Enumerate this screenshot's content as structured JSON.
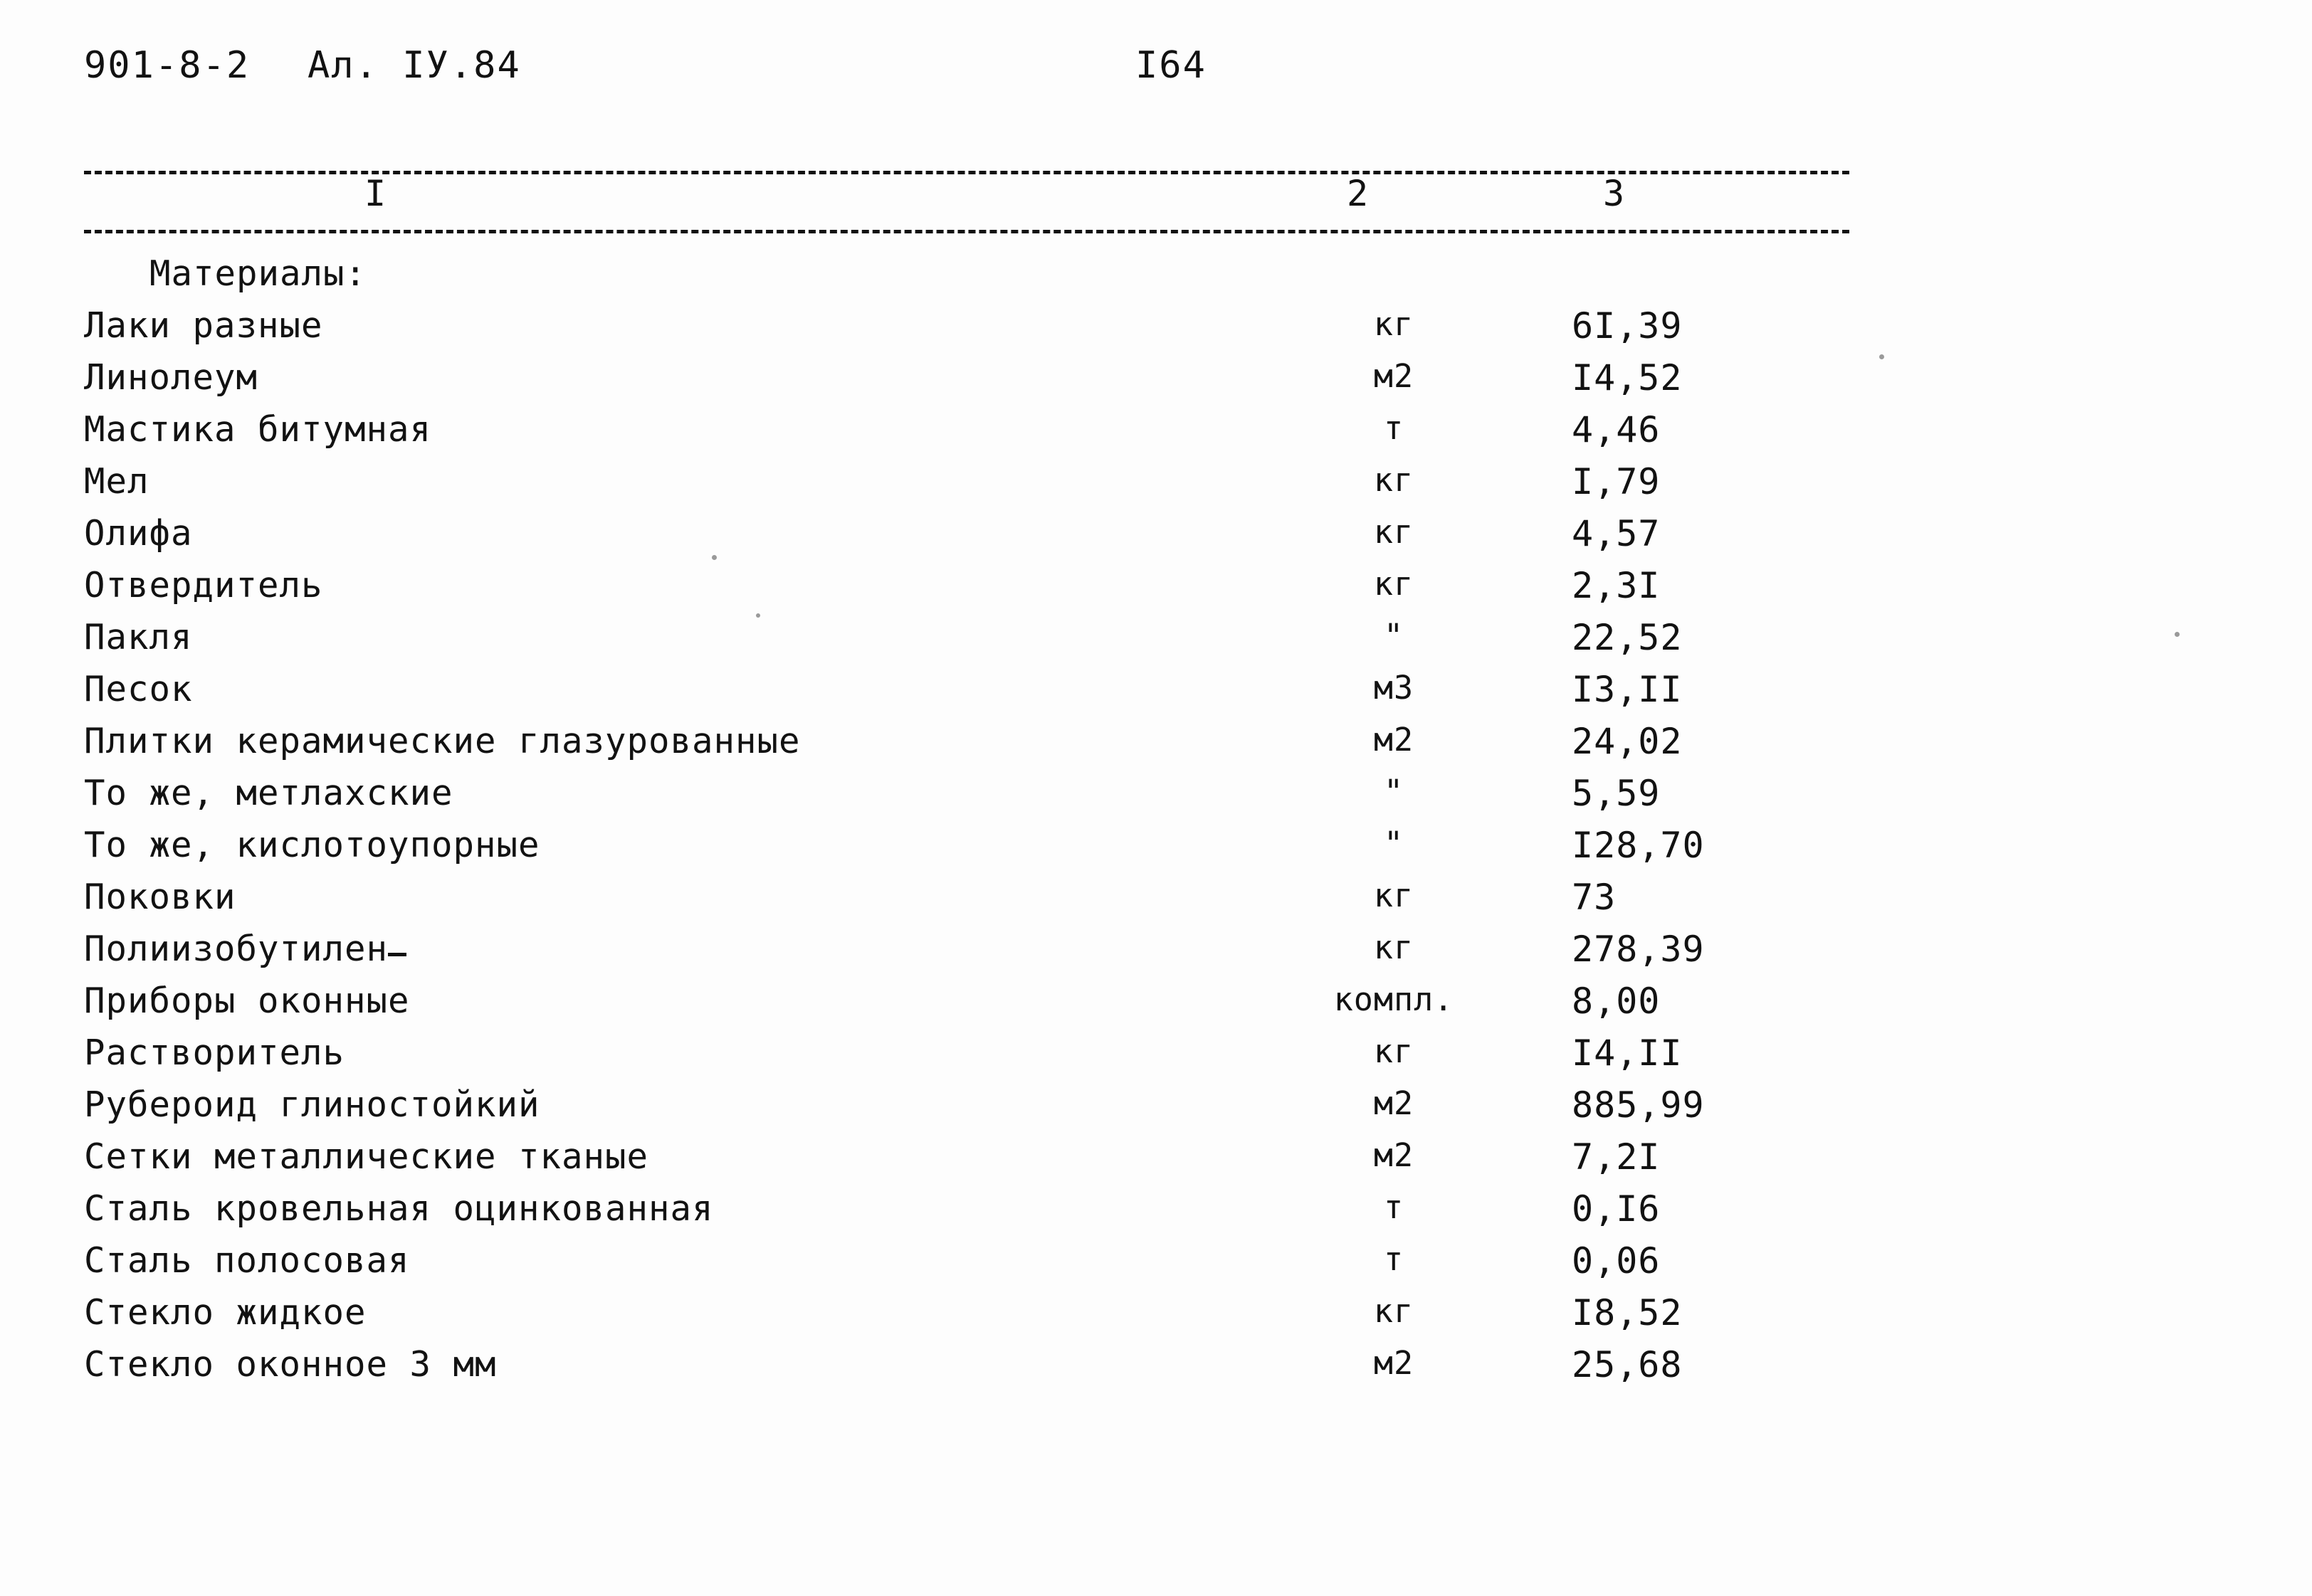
{
  "header": {
    "doc_code": "901-8-2",
    "album": "Ал. IУ.84",
    "page_number": "I64"
  },
  "table": {
    "column_numbers": [
      "I",
      "2",
      "3"
    ],
    "section_title": "Материалы:",
    "rows": [
      {
        "name": "Лаки разные",
        "unit": "кг",
        "value": "6I,39"
      },
      {
        "name": "Линолеум",
        "unit": "м2",
        "value": "I4,52"
      },
      {
        "name": "Мастика битумная",
        "unit": "т",
        "value": "4,46"
      },
      {
        "name": "Мел",
        "unit": "кг",
        "value": "I,79"
      },
      {
        "name": "Олифа",
        "unit": "кг",
        "value": "4,57"
      },
      {
        "name": "Отвердитель",
        "unit": "кг",
        "value": "2,3I"
      },
      {
        "name": "Пакля",
        "unit": "\"",
        "value": "22,52"
      },
      {
        "name": "Песок",
        "unit": "м3",
        "value": "I3,II"
      },
      {
        "name": "Плитки керамические глазурованные",
        "unit": "м2",
        "value": "24,02"
      },
      {
        "name": "То же, метлахские",
        "unit": "\"",
        "value": "5,59"
      },
      {
        "name": "То же, кислотоупорные",
        "unit": "\"",
        "value": "I28,70"
      },
      {
        "name": "Поковки",
        "unit": "кг",
        "value": "73"
      },
      {
        "name": "Полиизобутилен",
        "unit": "кг",
        "value": "278,39"
      },
      {
        "name": "Приборы оконные",
        "unit": "компл.",
        "value": "8,00"
      },
      {
        "name": "Растворитель",
        "unit": "кг",
        "value": "I4,II"
      },
      {
        "name": "Рубероид глиностойкий",
        "unit": "м2",
        "value": "885,99"
      },
      {
        "name": "Сетки металлические тканые",
        "unit": "м2",
        "value": "7,2I"
      },
      {
        "name": "Сталь кровельная оцинкованная",
        "unit": "т",
        "value": "0,I6"
      },
      {
        "name": "Сталь полосовая",
        "unit": "т",
        "value": "0,06"
      },
      {
        "name": "Стекло жидкое",
        "unit": "кг",
        "value": "I8,52"
      },
      {
        "name": "Стекло оконное 3 мм",
        "unit": "м2",
        "value": "25,68"
      }
    ]
  },
  "colors": {
    "ink": "#121212",
    "paper": "#fdfdfd"
  }
}
